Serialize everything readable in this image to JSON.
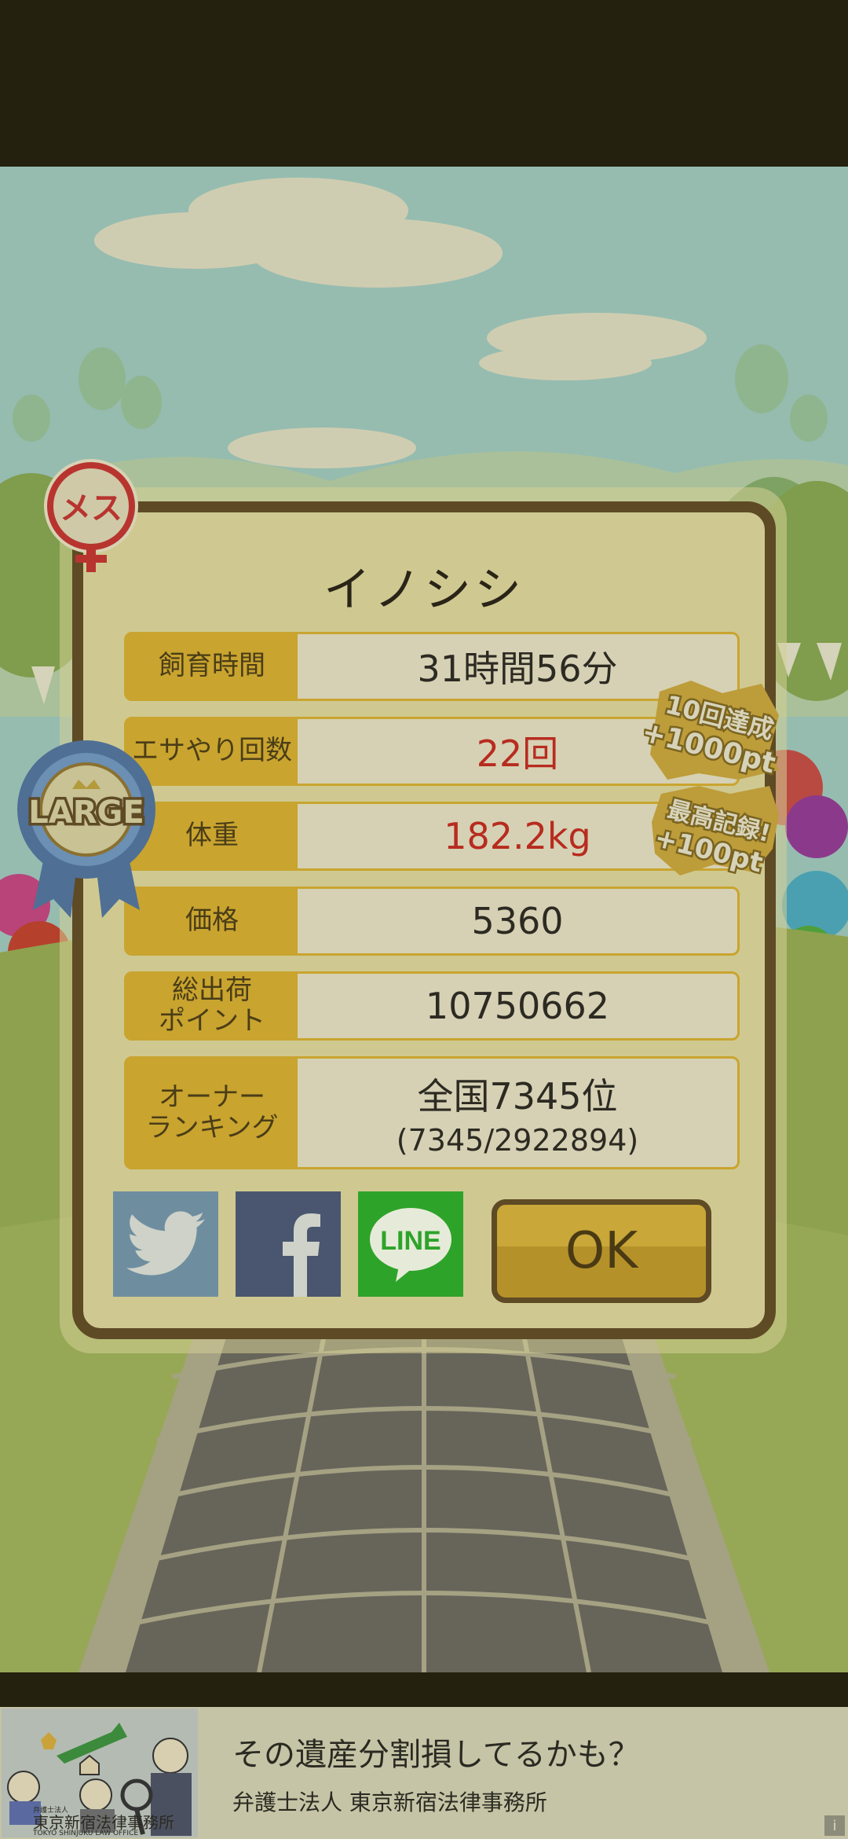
{
  "dialog": {
    "title": "イノシシ",
    "rows": [
      {
        "label": "飼育時間",
        "value": "31時間56分"
      },
      {
        "label": "エサやり回数",
        "value": "22回"
      },
      {
        "label": "体重",
        "value": "182.2kg"
      },
      {
        "label": "価格",
        "value": "5360"
      },
      {
        "label": "総出荷\nポイント",
        "value": "10750662"
      },
      {
        "label": "オーナー\nランキング",
        "value": "全国7345位",
        "value_sub": "(7345/2922894)"
      }
    ],
    "ok_label": "OK"
  },
  "badges": {
    "gender": "メス",
    "size": "LARGE",
    "bonus_1_line1": "10回達成",
    "bonus_1_line2": "+1000pt",
    "bonus_2_line1": "最高記録!",
    "bonus_2_line2": "+100pt"
  },
  "social": {
    "twitter_icon": "twitter-icon",
    "facebook_icon": "facebook-icon",
    "line_label": "LINE"
  },
  "ad": {
    "headline": "その遺産分割損してるかも？",
    "sub": "弁護士法人 東京新宿法律事務所",
    "logo_main": "東京新宿法律事務所",
    "logo_small": "TOKYO SHINJUKU LAW OFFICE",
    "logo_top": "弁護士法人",
    "info": "i"
  },
  "colors": {
    "dialog_bg": "#cfc991",
    "dialog_border": "#5e4a25",
    "label_bg": "#c9a42f",
    "value_bg": "#d6d1b4",
    "highlight_text": "#b82b1f",
    "twitter": "#6e8ea0",
    "facebook": "#4a5670",
    "line": "#2ea32a"
  }
}
